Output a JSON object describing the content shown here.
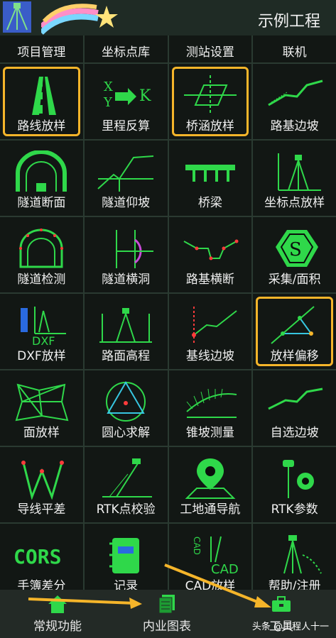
{
  "header": {
    "title": "示例工程"
  },
  "grid": {
    "row0": [
      "项目管理",
      "坐标点库",
      "测站设置",
      "联机"
    ],
    "items": [
      {
        "label": "路线放样",
        "icon": "road-icon"
      },
      {
        "label": "里程反算",
        "icon": "xy-to-k-icon"
      },
      {
        "label": "桥涵放样",
        "icon": "culvert-icon"
      },
      {
        "label": "路基边坡",
        "icon": "slope-icon"
      },
      {
        "label": "隧道断面",
        "icon": "tunnel-section-icon"
      },
      {
        "label": "隧道仰坡",
        "icon": "tunnel-slope-icon"
      },
      {
        "label": "桥梁",
        "icon": "bridge-icon"
      },
      {
        "label": "坐标点放样",
        "icon": "point-stakeout-icon"
      },
      {
        "label": "隧道检测",
        "icon": "tunnel-inspect-icon"
      },
      {
        "label": "隧道横洞",
        "icon": "cross-tunnel-icon"
      },
      {
        "label": "路基横断",
        "icon": "cross-section-icon"
      },
      {
        "label": "采集/面积",
        "icon": "collect-area-icon"
      },
      {
        "label": "DXF放样",
        "icon": "dxf-icon"
      },
      {
        "label": "路面高程",
        "icon": "pavement-elev-icon"
      },
      {
        "label": "基线边坡",
        "icon": "baseline-slope-icon"
      },
      {
        "label": "放样偏移",
        "icon": "offset-stakeout-icon"
      },
      {
        "label": "面放样",
        "icon": "surface-stakeout-icon"
      },
      {
        "label": "圆心求解",
        "icon": "circle-center-icon"
      },
      {
        "label": "锥坡测量",
        "icon": "cone-slope-icon"
      },
      {
        "label": "自选边坡",
        "icon": "custom-slope-icon"
      },
      {
        "label": "导线平差",
        "icon": "traverse-adjust-icon"
      },
      {
        "label": "RTK点校验",
        "icon": "rtk-check-icon"
      },
      {
        "label": "工地通导航",
        "icon": "navigation-icon"
      },
      {
        "label": "RTK参数",
        "icon": "rtk-params-icon"
      },
      {
        "label": "手簿差分",
        "icon": "cors-icon"
      },
      {
        "label": "记录",
        "icon": "notebook-icon"
      },
      {
        "label": "CAD放样",
        "icon": "cad-stakeout-icon"
      },
      {
        "label": "帮助/注册",
        "icon": "help-register-icon"
      }
    ],
    "cors_text": "CORS",
    "dxf_text": "DXF",
    "cad_text": "CAD"
  },
  "bottom": {
    "tabs": [
      "常规功能",
      "内业图表",
      "工具"
    ],
    "watermark": "头条 @工程人十一"
  },
  "colors": {
    "accent": "#2fd84a",
    "highlight": "#f5b52a",
    "arrow": "#f5b52a"
  }
}
